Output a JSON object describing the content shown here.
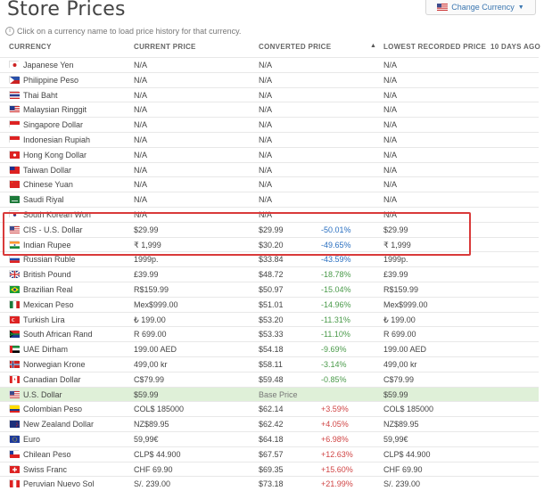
{
  "page": {
    "title": "Store Prices",
    "change_currency_label": "Change Currency",
    "hint": "Click on a currency name to load price history for that currency."
  },
  "table": {
    "headers": {
      "currency": "CURRENCY",
      "current_price": "CURRENT PRICE",
      "converted_price": "CONVERTED PRICE",
      "lowest_recorded_price": "LOWEST RECORDED PRICE",
      "lowest_ago": "10 DAYS AGO"
    },
    "rows": [
      {
        "flag": "jp",
        "name": "Japanese Yen",
        "current": "N/A",
        "converted": "N/A",
        "pct": "",
        "lowest": "N/A"
      },
      {
        "flag": "ph",
        "name": "Philippine Peso",
        "current": "N/A",
        "converted": "N/A",
        "pct": "",
        "lowest": "N/A"
      },
      {
        "flag": "th",
        "name": "Thai Baht",
        "current": "N/A",
        "converted": "N/A",
        "pct": "",
        "lowest": "N/A"
      },
      {
        "flag": "my",
        "name": "Malaysian Ringgit",
        "current": "N/A",
        "converted": "N/A",
        "pct": "",
        "lowest": "N/A"
      },
      {
        "flag": "sg",
        "name": "Singapore Dollar",
        "current": "N/A",
        "converted": "N/A",
        "pct": "",
        "lowest": "N/A"
      },
      {
        "flag": "id",
        "name": "Indonesian Rupiah",
        "current": "N/A",
        "converted": "N/A",
        "pct": "",
        "lowest": "N/A"
      },
      {
        "flag": "hk",
        "name": "Hong Kong Dollar",
        "current": "N/A",
        "converted": "N/A",
        "pct": "",
        "lowest": "N/A"
      },
      {
        "flag": "tw",
        "name": "Taiwan Dollar",
        "current": "N/A",
        "converted": "N/A",
        "pct": "",
        "lowest": "N/A"
      },
      {
        "flag": "cn",
        "name": "Chinese Yuan",
        "current": "N/A",
        "converted": "N/A",
        "pct": "",
        "lowest": "N/A"
      },
      {
        "flag": "sa",
        "name": "Saudi Riyal",
        "current": "N/A",
        "converted": "N/A",
        "pct": "",
        "lowest": "N/A"
      },
      {
        "flag": "kr",
        "name": "South Korean Won",
        "current": "N/A",
        "converted": "N/A",
        "pct": "",
        "lowest": "N/A"
      },
      {
        "flag": "cis",
        "name": "CIS - U.S. Dollar",
        "current": "$29.99",
        "converted": "$29.99",
        "pct": "-50.01%",
        "lowest": "$29.99"
      },
      {
        "flag": "in",
        "name": "Indian Rupee",
        "current": "₹ 1,999",
        "converted": "$30.20",
        "pct": "-49.65%",
        "lowest": "₹ 1,999"
      },
      {
        "flag": "ru",
        "name": "Russian Ruble",
        "current": "1999р.",
        "converted": "$33.84",
        "pct": "-43.59%",
        "lowest": "1999р."
      },
      {
        "flag": "gb",
        "name": "British Pound",
        "current": "£39.99",
        "converted": "$48.72",
        "pct": "-18.78%",
        "lowest": "£39.99"
      },
      {
        "flag": "br",
        "name": "Brazilian Real",
        "current": "R$159.99",
        "converted": "$50.97",
        "pct": "-15.04%",
        "lowest": "R$159.99"
      },
      {
        "flag": "mx",
        "name": "Mexican Peso",
        "current": "Mex$999.00",
        "converted": "$51.01",
        "pct": "-14.96%",
        "lowest": "Mex$999.00"
      },
      {
        "flag": "tr",
        "name": "Turkish Lira",
        "current": "₺ 199.00",
        "converted": "$53.20",
        "pct": "-11.31%",
        "lowest": "₺ 199.00"
      },
      {
        "flag": "za",
        "name": "South African Rand",
        "current": "R 699.00",
        "converted": "$53.33",
        "pct": "-11.10%",
        "lowest": "R 699.00"
      },
      {
        "flag": "ae",
        "name": "UAE Dirham",
        "current": "199.00 AED",
        "converted": "$54.18",
        "pct": "-9.69%",
        "lowest": "199.00 AED"
      },
      {
        "flag": "no",
        "name": "Norwegian Krone",
        "current": "499,00 kr",
        "converted": "$58.11",
        "pct": "-3.14%",
        "lowest": "499,00 kr"
      },
      {
        "flag": "ca",
        "name": "Canadian Dollar",
        "current": "C$79.99",
        "converted": "$59.48",
        "pct": "-0.85%",
        "lowest": "C$79.99"
      },
      {
        "flag": "us",
        "name": "U.S. Dollar",
        "current": "$59.99",
        "converted": "Base Price",
        "pct": "",
        "lowest": "$59.99"
      },
      {
        "flag": "co",
        "name": "Colombian Peso",
        "current": "COL$ 185000",
        "converted": "$62.14",
        "pct": "+3.59%",
        "lowest": "COL$ 185000"
      },
      {
        "flag": "nz",
        "name": "New Zealand Dollar",
        "current": "NZ$89.95",
        "converted": "$62.42",
        "pct": "+4.05%",
        "lowest": "NZ$89.95"
      },
      {
        "flag": "eu",
        "name": "Euro",
        "current": "59,99€",
        "converted": "$64.18",
        "pct": "+6.98%",
        "lowest": "59,99€"
      },
      {
        "flag": "cl",
        "name": "Chilean Peso",
        "current": "CLP$ 44.900",
        "converted": "$67.57",
        "pct": "+12.63%",
        "lowest": "CLP$ 44.900"
      },
      {
        "flag": "ch",
        "name": "Swiss Franc",
        "current": "CHF 69.90",
        "converted": "$69.35",
        "pct": "+15.60%",
        "lowest": "CHF 69.90"
      },
      {
        "flag": "pe",
        "name": "Peruvian Nuevo Sol",
        "current": "S/. 239.00",
        "converted": "$73.18",
        "pct": "+21.99%",
        "lowest": "S/. 239.00"
      }
    ]
  },
  "colors": {
    "highlight_row": "#dff0d8",
    "negative_change": "#4a9a4a",
    "positive_change": "#d04545",
    "selection_box": "#d93a3a",
    "link": "#3a76b0"
  }
}
